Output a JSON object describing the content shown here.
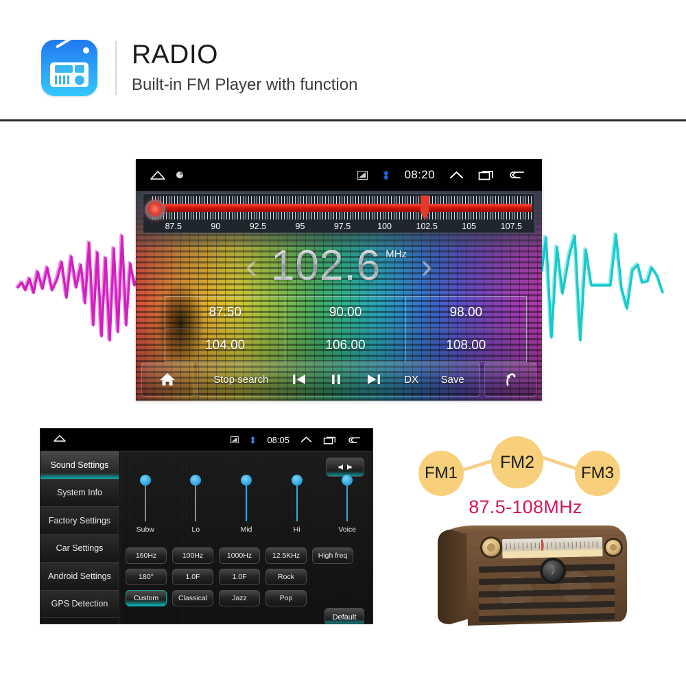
{
  "header": {
    "title": "RADIO",
    "subtitle": "Built-in FM  Player with function",
    "app_icon": "radio-app-icon",
    "accent_blue": "#2a9cf7"
  },
  "radio_screen": {
    "statusbar": {
      "home_icon": "home-outline-icon",
      "app_icon": "small-app-icon",
      "cast_icon": "screen-cast-icon",
      "bluetooth_icon": "bluetooth-icon",
      "bluetooth_color": "#1a6ef5",
      "time": "08:20",
      "expand_icon": "chevron-up-icon",
      "recents_icon": "recent-apps-icon",
      "back_icon": "back-arrow-icon"
    },
    "scale": {
      "labels": [
        "87.5",
        "90",
        "92.5",
        "95",
        "97.5",
        "100",
        "102.5",
        "105",
        "107.5"
      ],
      "bar_color": "#cf1408",
      "pointer_position_label": "102.5",
      "knob_icon": "tuning-knob-indicator"
    },
    "frequency": {
      "prev_icon": "chevron-left-icon",
      "value": "102.6",
      "unit": "MHz",
      "next_icon": "chevron-right-icon"
    },
    "presets": [
      "87.50",
      "90.00",
      "98.00",
      "104.00",
      "106.00",
      "108.00"
    ],
    "controls": {
      "home_icon": "home-icon",
      "stop_search_label": "Stop search",
      "prev_icon": "skip-previous-icon",
      "pause_icon": "pause-icon",
      "next_icon": "skip-next-icon",
      "dx_label": "DX",
      "save_label": "Save",
      "back_icon": "return-arrow-icon"
    }
  },
  "settings_screen": {
    "statusbar": {
      "home_icon": "home-outline-icon",
      "cast_icon": "screen-cast-icon",
      "bluetooth_icon": "bluetooth-icon",
      "time": "08:05",
      "expand_icon": "chevron-up-icon",
      "recents_icon": "recent-apps-icon",
      "back_icon": "back-arrow-icon"
    },
    "sidebar": [
      {
        "label": "Sound Settings",
        "active": true
      },
      {
        "label": "System Info",
        "active": false
      },
      {
        "label": "Factory Settings",
        "active": false
      },
      {
        "label": "Car Settings",
        "active": false
      },
      {
        "label": "Android Settings",
        "active": false
      },
      {
        "label": "GPS Detection",
        "active": false
      }
    ],
    "balance_button_icon": "speaker-balance-icon",
    "sliders": [
      {
        "label": "Subw"
      },
      {
        "label": "Lo"
      },
      {
        "label": "Mid"
      },
      {
        "label": "Hi"
      },
      {
        "label": "Voice"
      }
    ],
    "button_rows": [
      [
        {
          "label": "160Hz",
          "active": false
        },
        {
          "label": "100Hz",
          "active": false
        },
        {
          "label": "1000Hz",
          "active": false
        },
        {
          "label": "12.5KHz",
          "active": false
        },
        {
          "label": "High freq",
          "active": false
        }
      ],
      [
        {
          "label": "180°",
          "active": false
        },
        {
          "label": "1.0F",
          "active": false
        },
        {
          "label": "1.0F",
          "active": false
        },
        {
          "label": "Rock",
          "active": false
        }
      ],
      [
        {
          "label": "Custom",
          "active": true
        },
        {
          "label": "Classical",
          "active": false
        },
        {
          "label": "Jazz",
          "active": false
        },
        {
          "label": "Pop",
          "active": false
        }
      ]
    ],
    "default_button_label": "Default",
    "accent_teal": "#0fb3b3"
  },
  "fm_diagram": {
    "bubbles": [
      "FM1",
      "FM2",
      "FM3"
    ],
    "range_label": "87.5-108MHz",
    "bubble_color": "#f8cf7a",
    "range_color": "#d4145a"
  },
  "decorations": {
    "left_waveform": "magenta-waveform",
    "left_waveform_color": "#e03ad0",
    "right_waveform": "cyan-waveform",
    "right_waveform_color": "#25cfd2",
    "retro_radio": "retro-wooden-radio-image"
  }
}
